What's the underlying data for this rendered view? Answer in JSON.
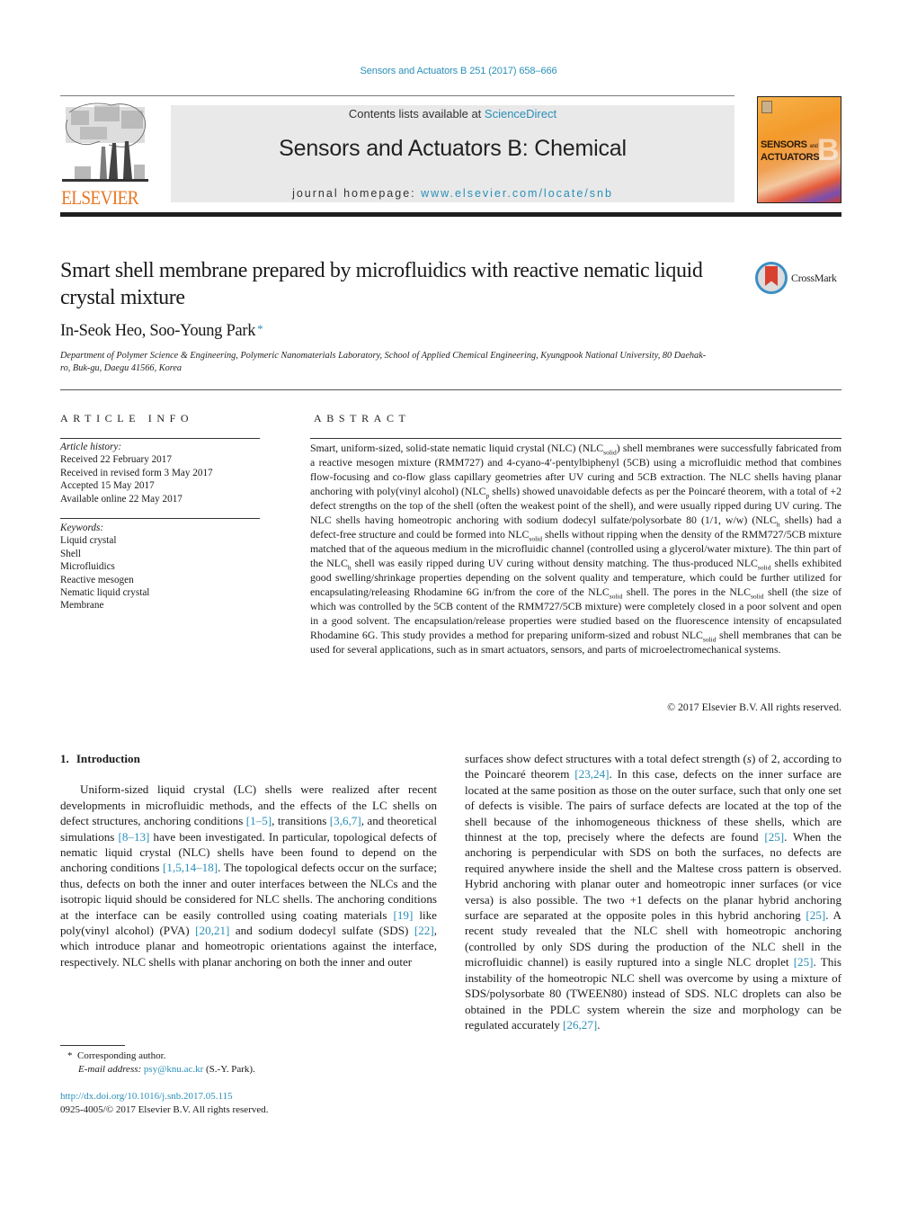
{
  "header": {
    "journal_ref": "Sensors and Actuators B 251 (2017) 658–666",
    "contents_prefix": "Contents lists available at ",
    "contents_link": "ScienceDirect",
    "journal_title": "Sensors and Actuators B: Chemical",
    "homepage_prefix": "journal homepage: ",
    "homepage_link": "www.elsevier.com/locate/snb",
    "publisher_logo": "ELSEVIER",
    "cover": {
      "title_line1": "SENSORS",
      "title_and": "and",
      "title_line2": "ACTUATORS",
      "letter": "B"
    },
    "colors": {
      "link": "#2a8fb8",
      "elsevier_orange": "#e87722",
      "header_box": "#e9e9e9"
    }
  },
  "article": {
    "title": "Smart shell membrane prepared by microfluidics with reactive nematic liquid crystal mixture",
    "crossmark_label": "CrossMark",
    "authors": "In-Seok Heo, Soo-Young Park",
    "corresponding_marker": "*",
    "affiliation": "Department of Polymer Science & Engineering, Polymeric Nanomaterials Laboratory, School of Applied Chemical Engineering, Kyungpook National University, 80 Daehak-ro, Buk-gu, Daegu 41566, Korea"
  },
  "article_info": {
    "heading": "ARTICLE INFO",
    "history_label": "Article history:",
    "history": [
      "Received 22 February 2017",
      "Received in revised form 3 May 2017",
      "Accepted 15 May 2017",
      "Available online 22 May 2017"
    ],
    "keywords_label": "Keywords:",
    "keywords": [
      "Liquid crystal",
      "Shell",
      "Microfluidics",
      "Reactive mesogen",
      "Nematic liquid crystal",
      "Membrane"
    ]
  },
  "abstract": {
    "heading": "ABSTRACT",
    "segments": [
      "Smart, uniform-sized, solid-state nematic liquid crystal (NLC) (NLC",
      "solid",
      ") shell membranes were successfully fabricated from a reactive mesogen mixture (RMM727) and 4-cyano-4′-pentylbiphenyl (5CB) using a microfluidic method that combines flow-focusing and co-flow glass capillary geometries after UV curing and 5CB extraction. The NLC shells having planar anchoring with poly(vinyl alcohol) (NLC",
      "p",
      " shells) showed unavoidable defects as per the Poincaré theorem, with a total of +2 defect strengths on the top of the shell (often the weakest point of the shell), and were usually ripped during UV curing. The NLC shells having homeotropic anchoring with sodium dodecyl sulfate/polysorbate 80 (1/1, w/w) (NLC",
      "h",
      " shells) had a defect-free structure and could be formed into NLC",
      "solid",
      " shells without ripping when the density of the RMM727/5CB mixture matched that of the aqueous medium in the microfluidic channel (controlled using a glycerol/water mixture). The thin part of the NLC",
      "h",
      " shell was easily ripped during UV curing without density matching. The thus-produced NLC",
      "solid",
      " shells exhibited good swelling/shrinkage properties depending on the solvent quality and temperature, which could be further utilized for encapsulating/releasing Rhodamine 6G in/from the core of the NLC",
      "solid",
      " shell. The pores in the NLC",
      "solid",
      " shell (the size of which was controlled by the 5CB content of the RMM727/5CB mixture) were completely closed in a poor solvent and open in a good solvent. The encapsulation/release properties were studied based on the fluorescence intensity of encapsulated Rhodamine 6G. This study provides a method for preparing uniform-sized and robust NLC",
      "solid",
      " shell membranes that can be used for several applications, such as in smart actuators, sensors, and parts of microelectromechanical systems."
    ],
    "copyright": "© 2017 Elsevier B.V. All rights reserved."
  },
  "introduction": {
    "number": "1.",
    "title": "Introduction",
    "left": [
      "Uniform-sized liquid crystal (LC) shells were realized after recent developments in microfluidic methods, and the effects of the LC shells on defect structures, anchoring conditions ",
      "[1–5]",
      ", transitions ",
      "[3,6,7]",
      ", and theoretical simulations ",
      "[8–13]",
      " have been investigated. In particular, topological defects of nematic liquid crystal (NLC) shells have been found to depend on the anchoring conditions ",
      "[1,5,14–18]",
      ". The topological defects occur on the surface; thus, defects on both the inner and outer interfaces between the NLCs and the isotropic liquid should be considered for NLC shells. The anchoring conditions at the interface can be easily controlled using coating materials ",
      "[19]",
      " like poly(vinyl alcohol) (PVA) ",
      "[20,21]",
      " and sodium dodecyl sulfate (SDS) ",
      "[22]",
      ", which introduce planar and homeotropic orientations against the interface, respectively. NLC shells with planar anchoring on both the inner and outer"
    ],
    "right": [
      "surfaces show defect structures with a total defect strength (",
      "s",
      ") of 2, according to the Poincaré theorem ",
      "[23,24]",
      ". In this case, defects on the inner surface are located at the same position as those on the outer surface, such that only one set of defects is visible. The pairs of surface defects are located at the top of the shell because of the inhomogeneous thickness of these shells, which are thinnest at the top, precisely where the defects are found ",
      "[25]",
      ". When the anchoring is perpendicular with SDS on both the surfaces, no defects are required anywhere inside the shell and the Maltese cross pattern is observed. Hybrid anchoring with planar outer and homeotropic inner surfaces (or vice versa) is also possible. The two +1 defects on the planar hybrid anchoring surface are separated at the opposite poles in this hybrid anchoring ",
      "[25]",
      ". A recent study revealed that the NLC shell with homeotropic anchoring (controlled by only SDS during the production of the NLC shell in the microfluidic channel) is easily ruptured into a single NLC droplet ",
      "[25]",
      ". This instability of the homeotropic NLC shell was overcome by using a mixture of SDS/polysorbate 80 (TWEEN80) instead of SDS. NLC droplets can also be obtained in the PDLC system wherein the size and morphology can be regulated accurately ",
      "[26,27]",
      "."
    ]
  },
  "footnote": {
    "marker": "*",
    "corresponding": "Corresponding author.",
    "email_label": "E-mail address:",
    "email": "psy@knu.ac.kr",
    "email_suffix": " (S.-Y. Park).",
    "doi": "http://dx.doi.org/10.1016/j.snb.2017.05.115",
    "issn_line": "0925-4005/© 2017 Elsevier B.V. All rights reserved."
  }
}
